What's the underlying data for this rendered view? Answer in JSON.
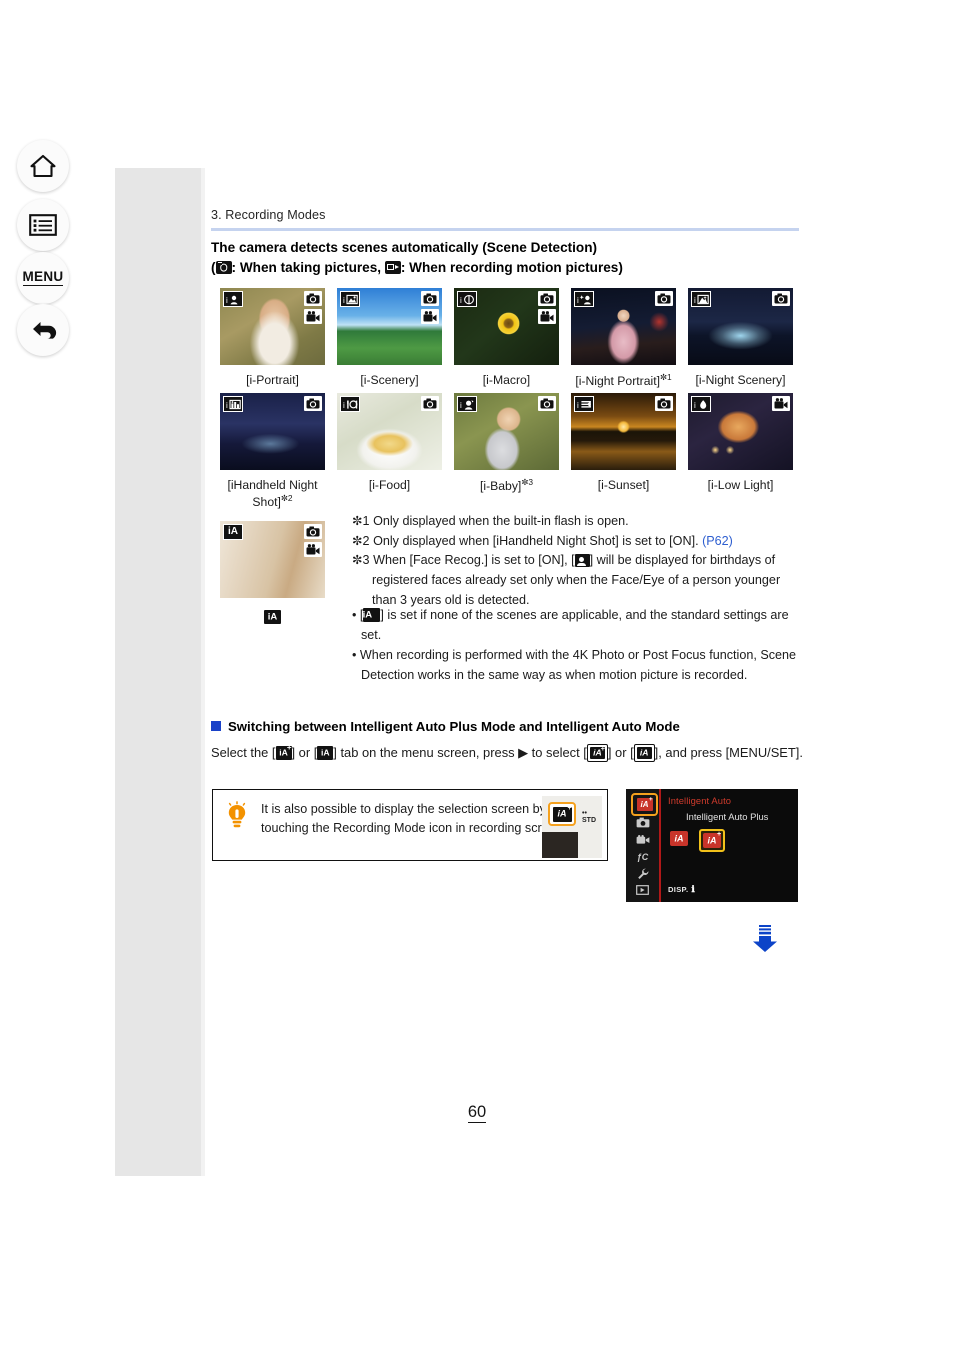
{
  "nav": {
    "items": [
      {
        "name": "home",
        "icon": "home-icon"
      },
      {
        "name": "contents",
        "icon": "contents-list-icon"
      },
      {
        "name": "menu",
        "icon": "menu-text-icon",
        "label": "MENU"
      },
      {
        "name": "back",
        "icon": "back-arrow-icon"
      }
    ]
  },
  "breadcrumb": "3. Recording Modes",
  "heading": {
    "line1": "The camera detects scenes automatically (Scene Detection)",
    "line2_prefix": "(",
    "line2_mid": ": When taking pictures, ",
    "line2_suffix": ": When recording motion pictures)"
  },
  "scene_thumbnails": [
    {
      "caption": "[i-Portrait]",
      "footnote": "",
      "badge": "portrait-icon",
      "media": [
        "photo",
        "video"
      ],
      "two_line": false
    },
    {
      "caption": "[i-Scenery]",
      "footnote": "",
      "badge": "scenery-icon",
      "media": [
        "photo",
        "video"
      ],
      "two_line": false
    },
    {
      "caption": "[i-Macro]",
      "footnote": "",
      "badge": "macro-flower-icon",
      "media": [
        "photo",
        "video"
      ],
      "two_line": false
    },
    {
      "caption": "[i-Night Portrait]",
      "footnote": "1",
      "badge": "night-portrait-icon",
      "media": [
        "photo"
      ],
      "two_line": false
    },
    {
      "caption": "[i-Night Scenery]",
      "footnote": "",
      "badge": "night-scenery-icon",
      "media": [
        "photo"
      ],
      "two_line": false
    },
    {
      "caption": "[iHandheld Night Shot]",
      "footnote": "2",
      "badge": "handheld-night-icon",
      "media": [
        "photo"
      ],
      "two_line": true
    },
    {
      "caption": "[i-Food]",
      "footnote": "",
      "badge": "food-icon",
      "media": [
        "photo"
      ],
      "two_line": false
    },
    {
      "caption": "[i-Baby]",
      "footnote": "3",
      "badge": "baby-icon",
      "media": [
        "photo"
      ],
      "two_line": false
    },
    {
      "caption": "[i-Sunset]",
      "footnote": "",
      "badge": "sunset-icon",
      "media": [
        "photo"
      ],
      "two_line": false
    },
    {
      "caption": "[i-Low Light]",
      "footnote": "",
      "badge": "low-light-icon",
      "media": [
        "video"
      ],
      "two_line": false
    },
    {
      "caption": "",
      "footnote": "",
      "badge": "ia-icon",
      "media": [
        "photo",
        "video"
      ],
      "two_line": false
    }
  ],
  "footnotes": [
    {
      "marker": "✼1",
      "text": "Only displayed when the built-in flash is open.",
      "link": ""
    },
    {
      "marker": "✼2",
      "text": "Only displayed when [iHandheld Night Shot] is set to [ON].",
      "link": "(P62)"
    },
    {
      "marker": "✼3",
      "text_a": "When [Face Recog.] is set to [ON], [",
      "text_b": "] will be displayed for birthdays of registered faces already set only when the Face/Eye of a person younger than 3 years old is detected.",
      "link": ""
    }
  ],
  "bullets": [
    {
      "prefix": "[",
      "suffix": "] is set if none of the scenes are applicable, and the standard settings are set.",
      "has_icon": true
    },
    {
      "text": "When recording is performed with the 4K Photo or Post Focus function, Scene Detection works in the same way as when motion picture is recorded.",
      "has_icon": false
    }
  ],
  "subhead": "Switching between Intelligent Auto Plus Mode and Intelligent Auto Mode",
  "select_paragraph": {
    "p1": "Select the [",
    "p2": "] or [",
    "p3": "] tab on the menu screen, press ",
    "arrow": "▶",
    "p4": " to select [",
    "p5": "] or [",
    "p6": "], and press [MENU/SET]."
  },
  "tip": {
    "text": "It is also possible to display the selection screen by touching the Recording Mode icon in recording screen.",
    "icon": "lightbulb-icon",
    "thumb_std_line1": "••",
    "thumb_std_line2": "STD"
  },
  "menu_screen": {
    "title": "Intelligent Auto",
    "subtitle": "Intelligent Auto Plus",
    "disp_label": "DISP.",
    "disp_glyph": "ℹ",
    "tabs": [
      {
        "name": "ia-tab",
        "glyph": "iA",
        "active": true
      },
      {
        "name": "rec-tab",
        "glyph": "camera-icon",
        "active": false
      },
      {
        "name": "motion-picture-tab",
        "glyph": "video-icon",
        "active": false
      },
      {
        "name": "custom-tab",
        "glyph": "Fc",
        "active": false
      },
      {
        "name": "setup-tab",
        "glyph": "wrench-icon",
        "active": false
      },
      {
        "name": "playback-tab",
        "glyph": "playback-icon",
        "active": false
      },
      {
        "name": "return-tab",
        "glyph": "back-arrow-icon",
        "active": false
      }
    ],
    "options": [
      {
        "name": "intelligent-auto-option",
        "glyph": "iA",
        "selected": false
      },
      {
        "name": "intelligent-auto-plus-option",
        "glyph": "iA+",
        "selected": true
      }
    ]
  },
  "next_arrow": {
    "name": "next-page-arrow",
    "color": "#0d44c8"
  },
  "page_number": "60",
  "colors": {
    "rule": "#c5d3ef",
    "link": "#2f5fd0",
    "accent_orange": "#f5a11e",
    "menu_red": "#cf3b2c",
    "blue_square": "#1a42c8",
    "sidebar": "#e6e6e6"
  }
}
